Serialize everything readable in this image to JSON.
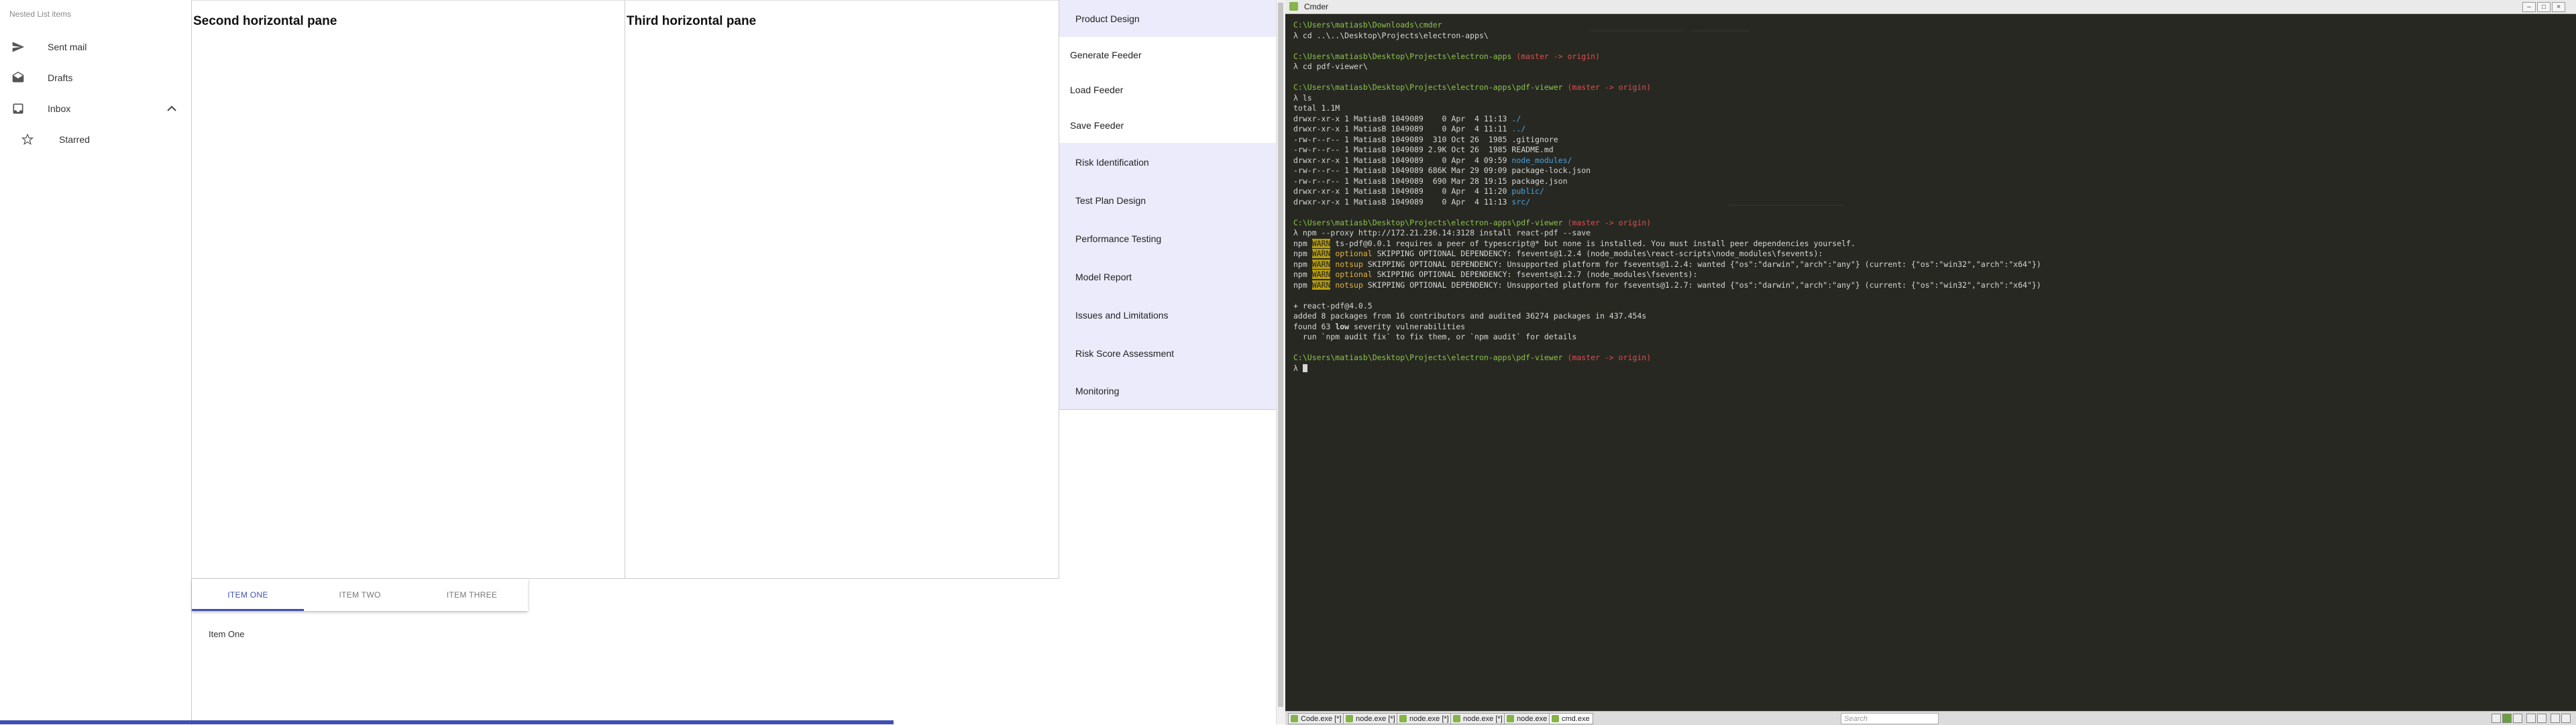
{
  "left": {
    "subheader": "Nested List items",
    "items": [
      {
        "label": "Sent mail",
        "icon": "send-icon"
      },
      {
        "label": "Drafts",
        "icon": "drafts-icon"
      },
      {
        "label": "Inbox",
        "icon": "inbox-icon"
      },
      {
        "label": "Starred",
        "icon": "star-icon"
      }
    ]
  },
  "panes": {
    "second_title": "Second horizontal pane",
    "third_title": "Third horizontal pane"
  },
  "tabs": {
    "items": [
      "ITEM ONE",
      "ITEM TWO",
      "ITEM THREE"
    ],
    "active_index": 0,
    "content": "Item One",
    "accent": "#3f51b5"
  },
  "menu": {
    "items": [
      {
        "label": "Product Design",
        "highlighted": true
      },
      {
        "label": "Generate Feeder",
        "highlighted": false
      },
      {
        "label": "Load Feeder",
        "highlighted": false
      },
      {
        "label": "Save Feeder",
        "highlighted": false
      },
      {
        "label": "Risk Identification",
        "highlighted": true
      },
      {
        "label": "Test Plan Design",
        "highlighted": true
      },
      {
        "label": "Performance Testing",
        "highlighted": true
      },
      {
        "label": "Model Report",
        "highlighted": true
      },
      {
        "label": "Issues and Limitations",
        "highlighted": true
      },
      {
        "label": "Risk Score Assessment",
        "highlighted": true
      },
      {
        "label": "Monitoring",
        "highlighted": true
      }
    ],
    "highlight_color": "#ebebfb"
  },
  "terminal": {
    "window_title": "Cmder",
    "lines": [
      [
        {
          "t": "C:\\Users\\matiasb\\Downloads\\cmder",
          "c": "green"
        }
      ],
      [
        {
          "t": "λ cd ..\\..\\Desktop\\Projects\\electron-apps\\",
          "c": ""
        }
      ],
      [
        {
          "t": "",
          "c": ""
        }
      ],
      [
        {
          "t": "C:\\Users\\matiasb\\Desktop\\Projects\\electron-apps ",
          "c": "green"
        },
        {
          "t": "(master -> origin)",
          "c": "red"
        }
      ],
      [
        {
          "t": "λ cd pdf-viewer\\",
          "c": ""
        }
      ],
      [
        {
          "t": "",
          "c": ""
        }
      ],
      [
        {
          "t": "C:\\Users\\matiasb\\Desktop\\Projects\\electron-apps\\pdf-viewer ",
          "c": "green"
        },
        {
          "t": "(master -> origin)",
          "c": "red"
        }
      ],
      [
        {
          "t": "λ ls",
          "c": ""
        }
      ],
      [
        {
          "t": "total 1.1M",
          "c": ""
        }
      ],
      [
        {
          "t": "drwxr-xr-x 1 MatiasB 1049089    0 Apr  4 11:13 ",
          "c": ""
        },
        {
          "t": "./",
          "c": "blue"
        }
      ],
      [
        {
          "t": "drwxr-xr-x 1 MatiasB 1049089    0 Apr  4 11:11 ",
          "c": ""
        },
        {
          "t": "../",
          "c": "blue"
        }
      ],
      [
        {
          "t": "-rw-r--r-- 1 MatiasB 1049089  310 Oct 26  1985 .gitignore",
          "c": ""
        }
      ],
      [
        {
          "t": "-rw-r--r-- 1 MatiasB 1049089 2.9K Oct 26  1985 README.md",
          "c": ""
        }
      ],
      [
        {
          "t": "drwxr-xr-x 1 MatiasB 1049089    0 Apr  4 09:59 ",
          "c": ""
        },
        {
          "t": "node_modules/",
          "c": "blue"
        }
      ],
      [
        {
          "t": "-rw-r--r-- 1 MatiasB 1049089 686K Mar 29 09:09 package-lock.json",
          "c": ""
        }
      ],
      [
        {
          "t": "-rw-r--r-- 1 MatiasB 1049089  690 Mar 28 19:15 package.json",
          "c": ""
        }
      ],
      [
        {
          "t": "drwxr-xr-x 1 MatiasB 1049089    0 Apr  4 11:20 ",
          "c": ""
        },
        {
          "t": "public/",
          "c": "blue"
        }
      ],
      [
        {
          "t": "drwxr-xr-x 1 MatiasB 1049089    0 Apr  4 11:13 ",
          "c": ""
        },
        {
          "t": "src/",
          "c": "blue"
        }
      ],
      [
        {
          "t": "",
          "c": ""
        }
      ],
      [
        {
          "t": "C:\\Users\\matiasb\\Desktop\\Projects\\electron-apps\\pdf-viewer ",
          "c": "green"
        },
        {
          "t": "(master -> origin)",
          "c": "red"
        }
      ],
      [
        {
          "t": "λ npm --proxy http://172.21.236.14:3128 install react-pdf --save",
          "c": ""
        }
      ],
      [
        {
          "t": "npm ",
          "c": ""
        },
        {
          "t": "WARN",
          "c": "warnbg"
        },
        {
          "t": " ts-pdf@0.0.1 requires a peer of typescript@* but none is installed. You must install peer dependencies yourself.",
          "c": ""
        }
      ],
      [
        {
          "t": "npm ",
          "c": ""
        },
        {
          "t": "WARN",
          "c": "warnbg"
        },
        {
          "t": " optional",
          "c": "orange"
        },
        {
          "t": " SKIPPING OPTIONAL DEPENDENCY: fsevents@1.2.4 (node_modules\\react-scripts\\node_modules\\fsevents):",
          "c": ""
        }
      ],
      [
        {
          "t": "npm ",
          "c": ""
        },
        {
          "t": "WARN",
          "c": "warnbg"
        },
        {
          "t": " notsup",
          "c": "orange"
        },
        {
          "t": " SKIPPING OPTIONAL DEPENDENCY: Unsupported platform for fsevents@1.2.4: wanted {\"os\":\"darwin\",\"arch\":\"any\"} (current: {\"os\":\"win32\",\"arch\":\"x64\"})",
          "c": ""
        }
      ],
      [
        {
          "t": "npm ",
          "c": ""
        },
        {
          "t": "WARN",
          "c": "warnbg"
        },
        {
          "t": " optional",
          "c": "orange"
        },
        {
          "t": " SKIPPING OPTIONAL DEPENDENCY: fsevents@1.2.7 (node_modules\\fsevents):",
          "c": ""
        }
      ],
      [
        {
          "t": "npm ",
          "c": ""
        },
        {
          "t": "WARN",
          "c": "warnbg"
        },
        {
          "t": " notsup",
          "c": "orange"
        },
        {
          "t": " SKIPPING OPTIONAL DEPENDENCY: Unsupported platform for fsevents@1.2.7: wanted {\"os\":\"darwin\",\"arch\":\"any\"} (current: {\"os\":\"win32\",\"arch\":\"x64\"})",
          "c": ""
        }
      ],
      [
        {
          "t": "",
          "c": ""
        }
      ],
      [
        {
          "t": "+ react-pdf@4.0.5",
          "c": ""
        }
      ],
      [
        {
          "t": "added 8 packages from 16 contributors and audited 36274 packages in 437.454s",
          "c": ""
        }
      ],
      [
        {
          "t": "found 63 ",
          "c": ""
        },
        {
          "t": "low",
          "c": "bold"
        },
        {
          "t": " severity vulnerabilities",
          "c": ""
        }
      ],
      [
        {
          "t": "  run `npm audit fix` to fix them, or `npm audit` for details",
          "c": ""
        }
      ],
      [
        {
          "t": "",
          "c": ""
        }
      ],
      [
        {
          "t": "C:\\Users\\matiasb\\Desktop\\Projects\\electron-apps\\pdf-viewer ",
          "c": "green"
        },
        {
          "t": "(master -> origin)",
          "c": "red"
        }
      ],
      [
        {
          "t": "λ ",
          "c": ""
        },
        {
          "t": "",
          "c": "cursor"
        }
      ]
    ],
    "taskbar_tabs": [
      {
        "label": "Code.exe [*]",
        "active": false
      },
      {
        "label": "node.exe [*]",
        "active": false
      },
      {
        "label": "node.exe [*]",
        "active": false
      },
      {
        "label": "node.exe [*]",
        "active": false
      },
      {
        "label": "node.exe",
        "active": false
      },
      {
        "label": "cmd.exe",
        "active": true
      }
    ],
    "search_placeholder": "Search"
  }
}
